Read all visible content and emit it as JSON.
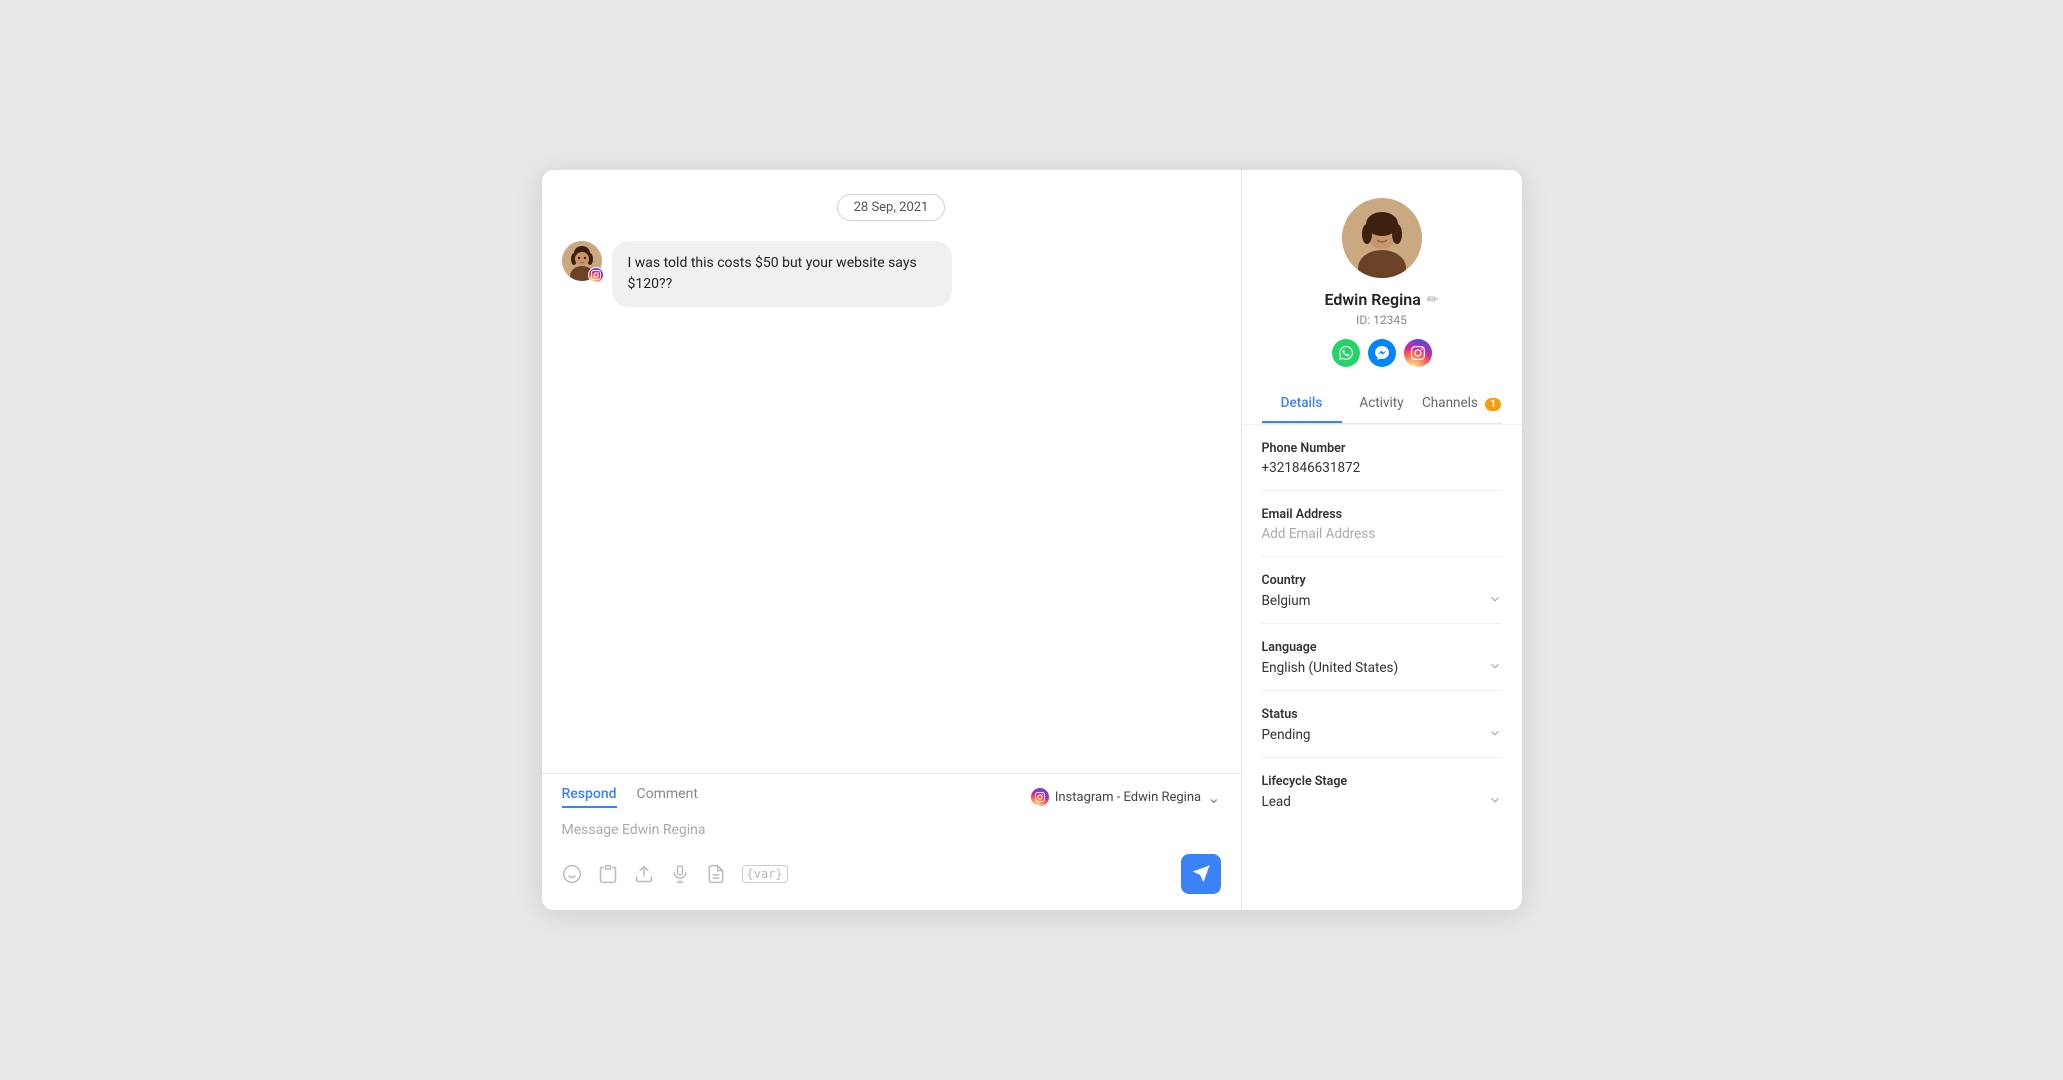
{
  "date_badge": "28 Sep, 2021",
  "message": {
    "text": "I was told this costs $50 but your website says $120??"
  },
  "chat_tabs": {
    "respond": "Respond",
    "comment": "Comment",
    "active": "respond"
  },
  "channel_selector": {
    "label": "Instagram - Edwin Regina",
    "platform": "instagram"
  },
  "message_input": {
    "placeholder": "Message Edwin Regina"
  },
  "toolbar": {
    "send_label": "Send"
  },
  "contact": {
    "name": "Edwin Regina",
    "id": "ID: 12345",
    "tabs": {
      "details": "Details",
      "activity": "Activity",
      "channels": "Channels",
      "channels_count": "1"
    },
    "phone_number_label": "Phone Number",
    "phone_number_value": "+321846631872",
    "email_label": "Email Address",
    "email_placeholder": "Add Email Address",
    "country_label": "Country",
    "country_value": "Belgium",
    "language_label": "Language",
    "language_value": "English (United States)",
    "status_label": "Status",
    "status_value": "Pending",
    "lifecycle_label": "Lifecycle Stage",
    "lifecycle_value": "Lead"
  },
  "icons": {
    "edit": "✏",
    "emoji": "☺",
    "clipboard": "📋",
    "upload": "⬆",
    "mic": "🎤",
    "note": "📄",
    "variable": "{var}",
    "chevron_down": "⌄",
    "send": "➤"
  },
  "colors": {
    "accent": "#3b82f6",
    "whatsapp": "#25d366",
    "messenger": "#0084ff",
    "instagram_badge": "#e1306c",
    "channels_badge": "#f59e0b"
  }
}
